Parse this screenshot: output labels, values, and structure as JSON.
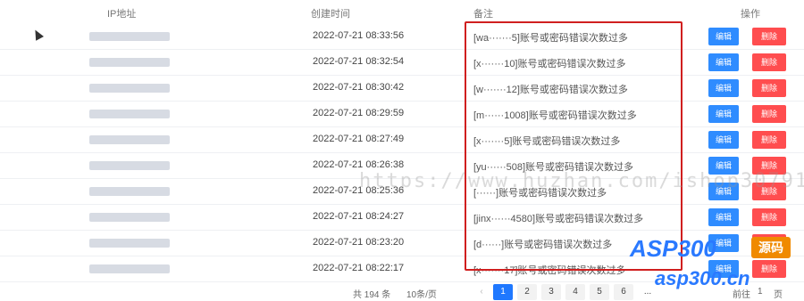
{
  "headers": {
    "ip": "IP地址",
    "time": "创建时间",
    "note": "备注",
    "op": "操作"
  },
  "buttons": {
    "edit": "编辑",
    "delete": "删除"
  },
  "rows": [
    {
      "time": "2022-07-21 08:33:56",
      "note": "[wa·······5]账号或密码错误次数过多"
    },
    {
      "time": "2022-07-21 08:32:54",
      "note": "[x·······10]账号或密码错误次数过多"
    },
    {
      "time": "2022-07-21 08:30:42",
      "note": "[w·······12]账号或密码错误次数过多"
    },
    {
      "time": "2022-07-21 08:29:59",
      "note": "[m······1008]账号或密码错误次数过多"
    },
    {
      "time": "2022-07-21 08:27:49",
      "note": "[x·······5]账号或密码错误次数过多"
    },
    {
      "time": "2022-07-21 08:26:38",
      "note": "[yu······508]账号或密码错误次数过多"
    },
    {
      "time": "2022-07-21 08:25:36",
      "note": "[······]账号或密码错误次数过多"
    },
    {
      "time": "2022-07-21 08:24:27",
      "note": "[jinx······4580]账号或密码错误次数过多"
    },
    {
      "time": "2022-07-21 08:23:20",
      "note": "[d······]账号或密码错误次数过多"
    },
    {
      "time": "2022-07-21 08:22:17",
      "note": "[x·······17]账号或密码错误次数过多"
    }
  ],
  "pagination": {
    "total": "共 194 条",
    "page_size": "10条/页",
    "prev": "‹",
    "pages": [
      "1",
      "2",
      "3",
      "4",
      "5",
      "6"
    ],
    "ellipsis": "...",
    "goto": "前往",
    "goto_value": "1",
    "page_suffix": "页"
  },
  "watermark": {
    "url": "https://www.huzhan.com/ishop30791",
    "logo": "ASP300",
    "logo_tag": "源码",
    "site": "asp300.cn"
  },
  "colors": {
    "edit": "#2f8cff",
    "delete": "#ff4d4f",
    "highlight": "#d01f1f",
    "active_page": "#1f78ff"
  }
}
